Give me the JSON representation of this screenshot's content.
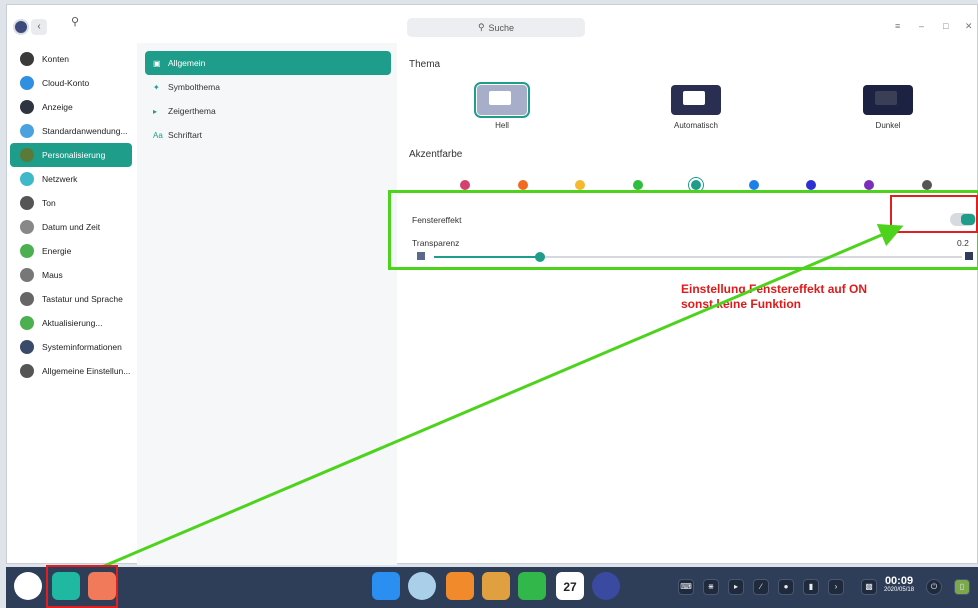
{
  "search": {
    "label": "Suche"
  },
  "sidebar": {
    "items": [
      {
        "label": "Konten",
        "icon": "user-icon",
        "color": "#3a3a3a"
      },
      {
        "label": "Cloud-Konto",
        "icon": "cloud-icon",
        "color": "#2f8fe0"
      },
      {
        "label": "Anzeige",
        "icon": "monitor-icon",
        "color": "#2e3440"
      },
      {
        "label": "Standardanwendung...",
        "icon": "default-apps-icon",
        "color": "#4aa3df"
      },
      {
        "label": "Personalisierung",
        "icon": "personalization-icon",
        "color": "#5b7a3a"
      },
      {
        "label": "Netzwerk",
        "icon": "network-icon",
        "color": "#3fb8c9"
      },
      {
        "label": "Ton",
        "icon": "speaker-icon",
        "color": "#555555"
      },
      {
        "label": "Datum und Zeit",
        "icon": "clock-icon",
        "color": "#888888"
      },
      {
        "label": "Energie",
        "icon": "battery-icon",
        "color": "#4caf50"
      },
      {
        "label": "Maus",
        "icon": "mouse-icon",
        "color": "#777777"
      },
      {
        "label": "Tastatur und Sprache",
        "icon": "keyboard-icon",
        "color": "#666666"
      },
      {
        "label": "Aktualisierung...",
        "icon": "update-icon",
        "color": "#4caf50"
      },
      {
        "label": "Systeminformationen",
        "icon": "system-info-icon",
        "color": "#3a4a6a"
      },
      {
        "label": "Allgemeine Einstellun...",
        "icon": "general-settings-icon",
        "color": "#555555"
      }
    ]
  },
  "subnav": {
    "items": [
      {
        "label": "Allgemein",
        "icon": "window-icon"
      },
      {
        "label": "Symbolthema",
        "icon": "icon-theme-icon"
      },
      {
        "label": "Zeigerthema",
        "icon": "cursor-icon"
      },
      {
        "label": "Schriftart",
        "icon": "font-icon"
      }
    ]
  },
  "theme": {
    "title": "Thema",
    "options": [
      {
        "label": "Hell",
        "selected": true
      },
      {
        "label": "Automatisch",
        "selected": false
      },
      {
        "label": "Dunkel",
        "selected": false
      }
    ]
  },
  "accent": {
    "title": "Akzentfarbe",
    "colors": [
      "#d6406d",
      "#f06a1f",
      "#f5b82e",
      "#2ebd3c",
      "#1e9d8a",
      "#1f7ee8",
      "#2f2fd6",
      "#7b2fb8",
      "#555555"
    ],
    "selected_index": 4
  },
  "window_effect": {
    "label": "Fenstereffekt",
    "enabled": true
  },
  "transparency": {
    "label": "Transparenz",
    "value_label": "0.2",
    "level": 0.2
  },
  "annotation": {
    "line1": "Einstellung Fenstereffekt auf ON",
    "line2": "sonst keine Funktion"
  },
  "dock": {
    "time": "00:09",
    "date": "2020/05/18",
    "calendar_day": "27"
  }
}
